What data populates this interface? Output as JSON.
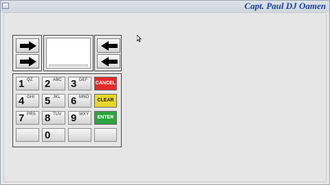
{
  "window": {
    "watermark": "Capt. Paul DJ Oamen"
  },
  "keypad": {
    "keys": [
      {
        "num": "1",
        "sub": "QZ"
      },
      {
        "num": "2",
        "sub": "ABC"
      },
      {
        "num": "3",
        "sub": "DEF"
      },
      {
        "num": "4",
        "sub": "GHI"
      },
      {
        "num": "5",
        "sub": "JKL"
      },
      {
        "num": "6",
        "sub": "MNO"
      },
      {
        "num": "7",
        "sub": "PRS"
      },
      {
        "num": "8",
        "sub": "TUV"
      },
      {
        "num": "9",
        "sub": "WXY"
      },
      {
        "num": "0",
        "sub": ""
      }
    ],
    "cancel": "CANCEL",
    "clear": "CLEAR",
    "enter": "ENTER"
  },
  "colors": {
    "cancel": "#e52a2a",
    "clear": "#e8d72a",
    "enter": "#2fa33f"
  },
  "icons": {
    "left_top": "arrow-right-icon",
    "left_bottom": "arrow-right-icon",
    "right_top": "arrow-left-icon",
    "right_bottom": "arrow-left-icon"
  }
}
